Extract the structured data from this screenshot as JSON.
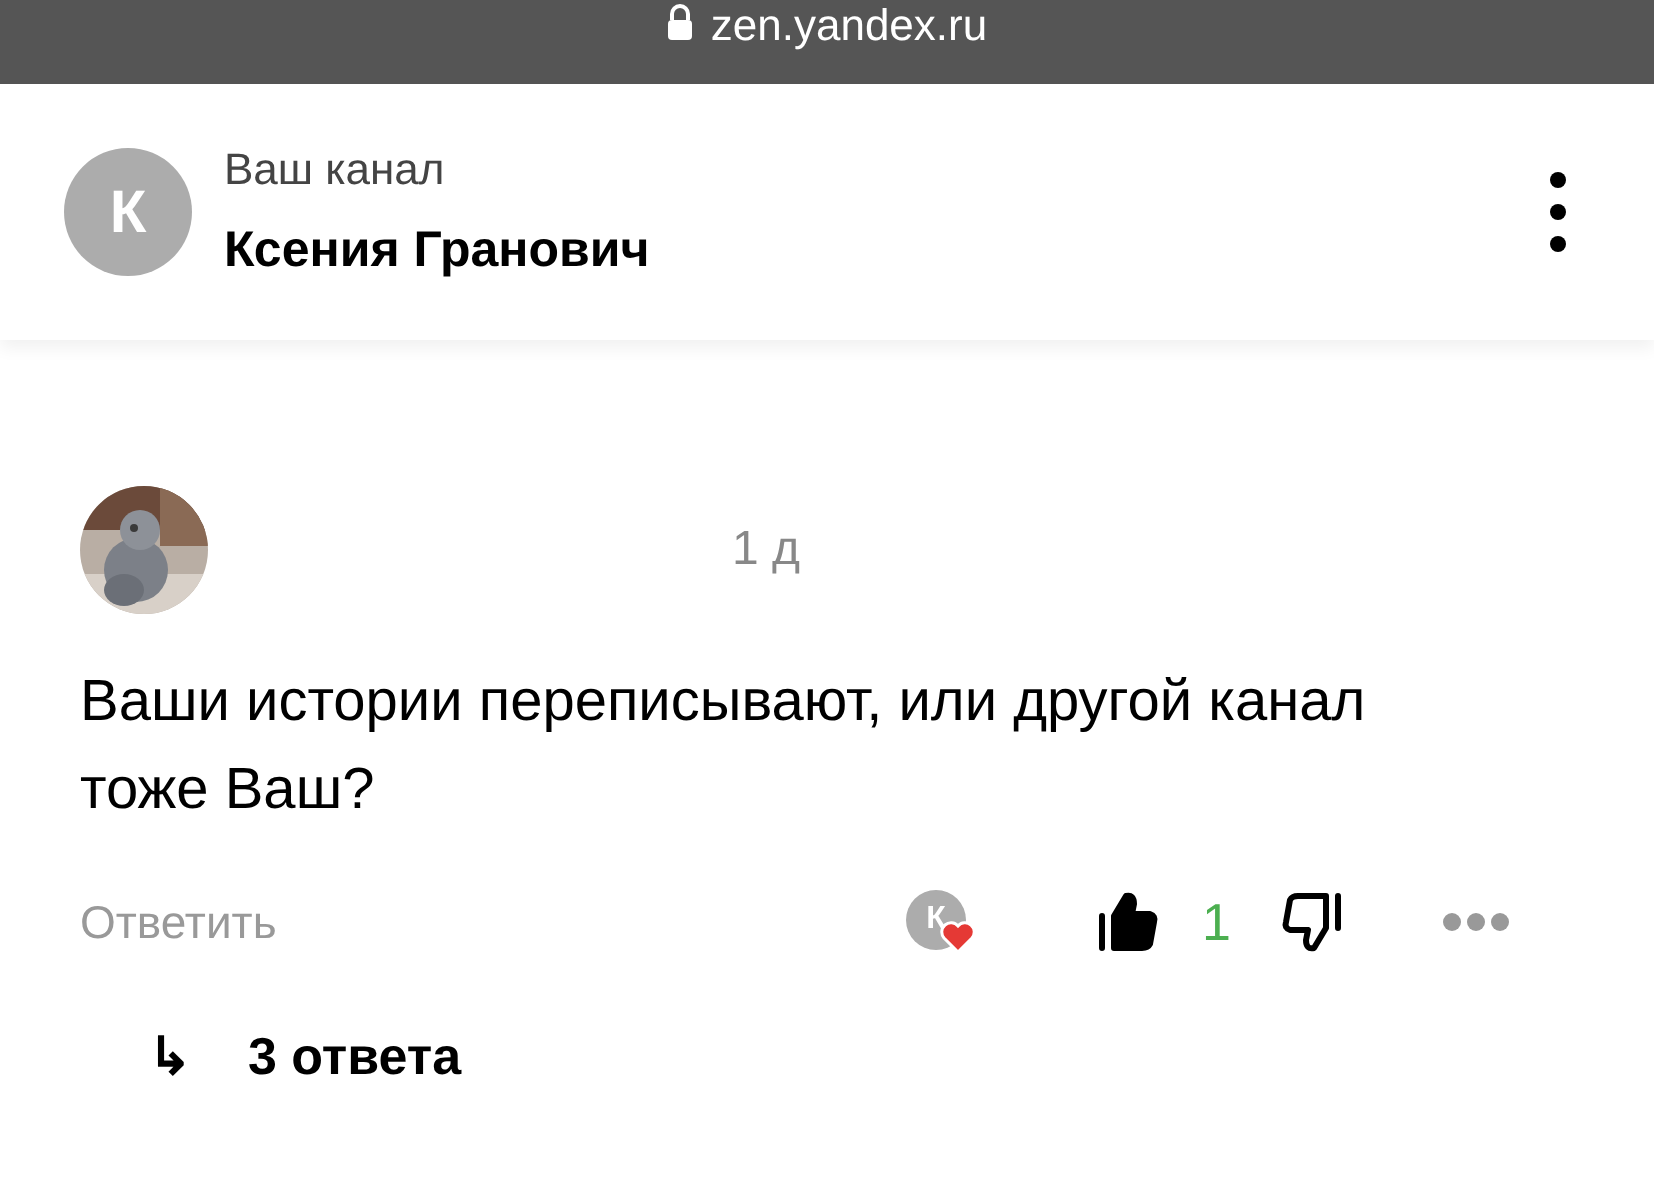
{
  "browser_bar": {
    "address": "zen.yandex.ru",
    "secure": true
  },
  "header": {
    "avatar_letter": "К",
    "subtitle": "Ваш канал",
    "title": "Ксения Гранович"
  },
  "comment": {
    "time": "1 д",
    "text": "Ваши истории переписывают, или другой канал тоже Ваш?",
    "reply_label": "Ответить",
    "author_like": {
      "letter": "К",
      "liked": true
    },
    "liked": true,
    "likes": "1",
    "disliked": false
  },
  "replies": {
    "arrow": "↳",
    "label": "3 ответа"
  }
}
